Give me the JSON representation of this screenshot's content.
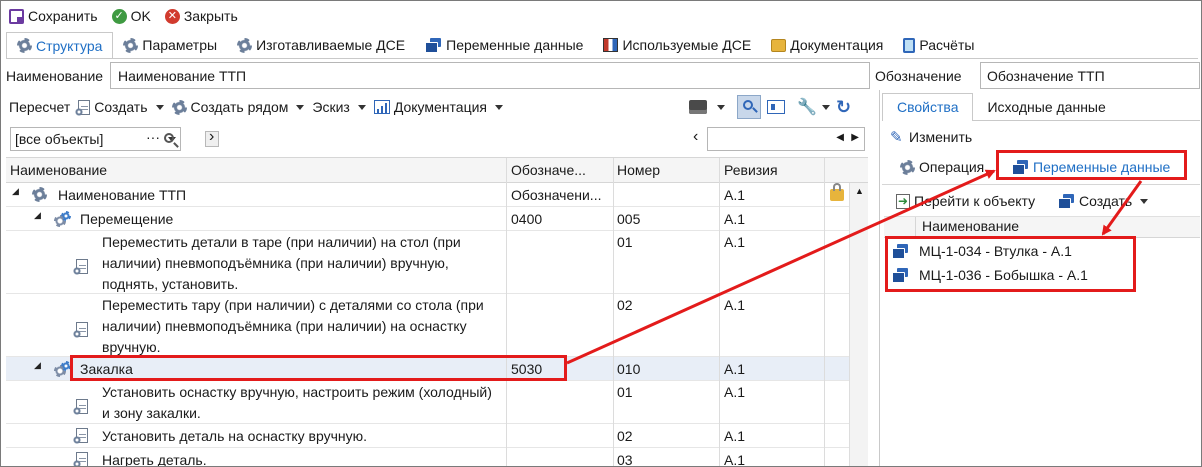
{
  "toolbar": {
    "save": "Сохранить",
    "ok": "OK",
    "close": "Закрыть"
  },
  "tabs": [
    "Структура",
    "Параметры",
    "Изготавливаемые ДСЕ",
    "Переменные данные",
    "Используемые ДСЕ",
    "Документация",
    "Расчёты"
  ],
  "name_field": {
    "label": "Наименование",
    "value": "Наименование ТТП"
  },
  "designation_field": {
    "label": "Обозначение",
    "value": "Обозначение ТТП"
  },
  "tree_toolbar": {
    "recount": "Пересчет",
    "create": "Создать",
    "create_near": "Создать рядом",
    "sketch": "Эскиз",
    "documentation": "Документация"
  },
  "filter": {
    "value": "[все объекты]",
    "dots": "···"
  },
  "grid": {
    "columns": [
      "Наименование",
      "Обозначе...",
      "Номер",
      "Ревизия"
    ],
    "rows": [
      {
        "name": "Наименование ТТП",
        "designation": "Обозначени...",
        "number": "",
        "revision": "А.1"
      },
      {
        "name": "Перемещение",
        "designation": "0400",
        "number": "005",
        "revision": "А.1"
      },
      {
        "name": "Переместить детали в таре (при наличии) на стол (при наличии) пневмоподъёмника (при наличии) вручную, поднять, установить.",
        "designation": "",
        "number": "01",
        "revision": "А.1"
      },
      {
        "name": "Переместить тару (при наличии) с деталями со стола (при наличии) пневмоподъёмника (при наличии) на оснастку вручную.",
        "designation": "",
        "number": "02",
        "revision": "А.1"
      },
      {
        "name": "Закалка",
        "designation": "5030",
        "number": "010",
        "revision": "А.1"
      },
      {
        "name": "Установить оснастку вручную, настроить режим (холодный) и зону закалки.",
        "designation": "",
        "number": "01",
        "revision": "А.1"
      },
      {
        "name": "Установить деталь на оснастку вручную.",
        "designation": "",
        "number": "02",
        "revision": "А.1"
      },
      {
        "name": "Нагреть деталь.",
        "designation": "",
        "number": "03",
        "revision": "А.1"
      }
    ]
  },
  "right_panel": {
    "tabs": [
      "Свойства",
      "Исходные данные"
    ],
    "edit": "Изменить",
    "subtabs": [
      "Операция",
      "Переменные данные"
    ],
    "goto": "Перейти к объекту",
    "create": "Создать",
    "list_header": "Наименование",
    "items": [
      "МЦ-1-034 - Втулка - А.1",
      "МЦ-1-036 - Бобышка - А.1"
    ]
  },
  "colors": {
    "accent": "#1f6fc5",
    "highlight": "#e31b1b",
    "selected_row": "#e8eef7"
  }
}
